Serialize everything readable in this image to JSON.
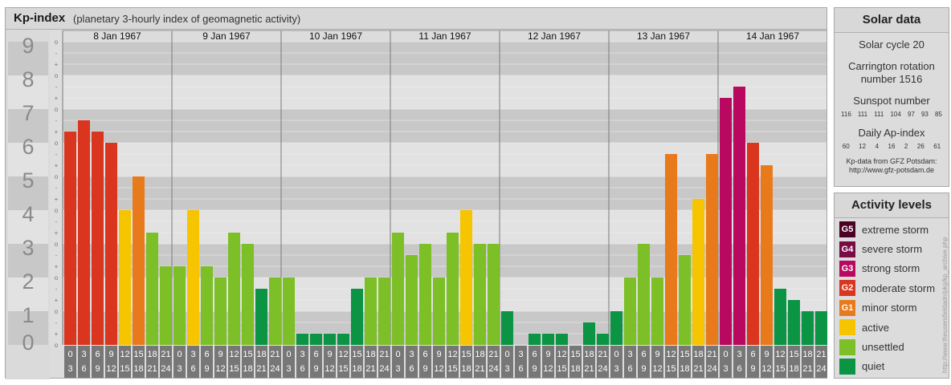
{
  "title": "Kp-index",
  "subtitle": "(planetary 3-hourly index of geomagnetic activity)",
  "chart_data": {
    "type": "bar",
    "ylim": [
      0,
      9
    ],
    "y_ticks": [
      "0",
      "1",
      "2",
      "3",
      "4",
      "5",
      "6",
      "7",
      "8",
      "9"
    ],
    "minor_tick_labels": [
      "o",
      "+",
      "-"
    ],
    "days": [
      "8 Jan 1967",
      "9 Jan 1967",
      "10 Jan 1967",
      "11 Jan 1967",
      "12 Jan 1967",
      "13 Jan 1967",
      "14 Jan 1967"
    ],
    "interval_labels": [
      [
        "0",
        "3"
      ],
      [
        "3",
        "6"
      ],
      [
        "6",
        "9"
      ],
      [
        "9",
        "12"
      ],
      [
        "12",
        "15"
      ],
      [
        "15",
        "18"
      ],
      [
        "18",
        "21"
      ],
      [
        "21",
        "24"
      ]
    ],
    "values": [
      [
        6.333,
        6.667,
        6.333,
        6.0,
        4.0,
        5.0,
        3.333,
        2.333
      ],
      [
        2.333,
        4.0,
        2.333,
        2.0,
        3.333,
        3.0,
        1.667,
        2.0
      ],
      [
        2.0,
        0.333,
        0.333,
        0.333,
        0.333,
        1.667,
        2.0,
        2.0
      ],
      [
        3.333,
        2.667,
        3.0,
        2.0,
        3.333,
        4.0,
        3.0,
        3.0
      ],
      [
        1.0,
        0.0,
        0.333,
        0.333,
        0.333,
        0.0,
        0.667,
        0.333
      ],
      [
        1.0,
        2.0,
        3.0,
        2.0,
        5.667,
        2.667,
        4.333,
        5.667
      ],
      [
        7.333,
        7.667,
        6.0,
        5.333,
        1.667,
        1.333,
        1.0,
        1.0
      ]
    ],
    "colors": {
      "G5": "#4d0026",
      "G4": "#7a0a45",
      "G3": "#b8085f",
      "G2": "#d9351f",
      "G1": "#e97a1c",
      "active": "#f7c400",
      "unsettled": "#7cbf26",
      "quiet": "#0a9444"
    },
    "band_dark": "#c8c8c8",
    "band_light": "#e2e2e2",
    "label_bg": "#777777"
  },
  "solar": {
    "title": "Solar data",
    "cycle": "Solar cycle 20",
    "carrington1": "Carrington rotation",
    "carrington2": "number 1516",
    "sunspot_title": "Sunspot number",
    "sunspot_values": [
      "116",
      "111",
      "111",
      "104",
      "97",
      "93",
      "85"
    ],
    "ap_title": "Daily Ap-index",
    "ap_values": [
      "60",
      "12",
      "4",
      "16",
      "2",
      "26",
      "61"
    ],
    "source1": "Kp-data from GFZ Potsdam:",
    "source2": "http://www.gfz-potsdam.de"
  },
  "activity": {
    "title": "Activity levels",
    "items": [
      {
        "code": "G5",
        "label": "extreme storm",
        "color": "#4d0026"
      },
      {
        "code": "G4",
        "label": "severe storm",
        "color": "#7a0a45"
      },
      {
        "code": "G3",
        "label": "strong storm",
        "color": "#b8085f"
      },
      {
        "code": "G2",
        "label": "moderate storm",
        "color": "#d9351f"
      },
      {
        "code": "G1",
        "label": "minor storm",
        "color": "#e97a1c"
      },
      {
        "code": "",
        "label": "active",
        "color": "#f7c400"
      },
      {
        "code": "",
        "label": "unsettled",
        "color": "#7cbf26"
      },
      {
        "code": "",
        "label": "quiet",
        "color": "#0a9444"
      }
    ]
  },
  "credit": "http://www.theusersfieldadn/pkg/kp_archive.php"
}
